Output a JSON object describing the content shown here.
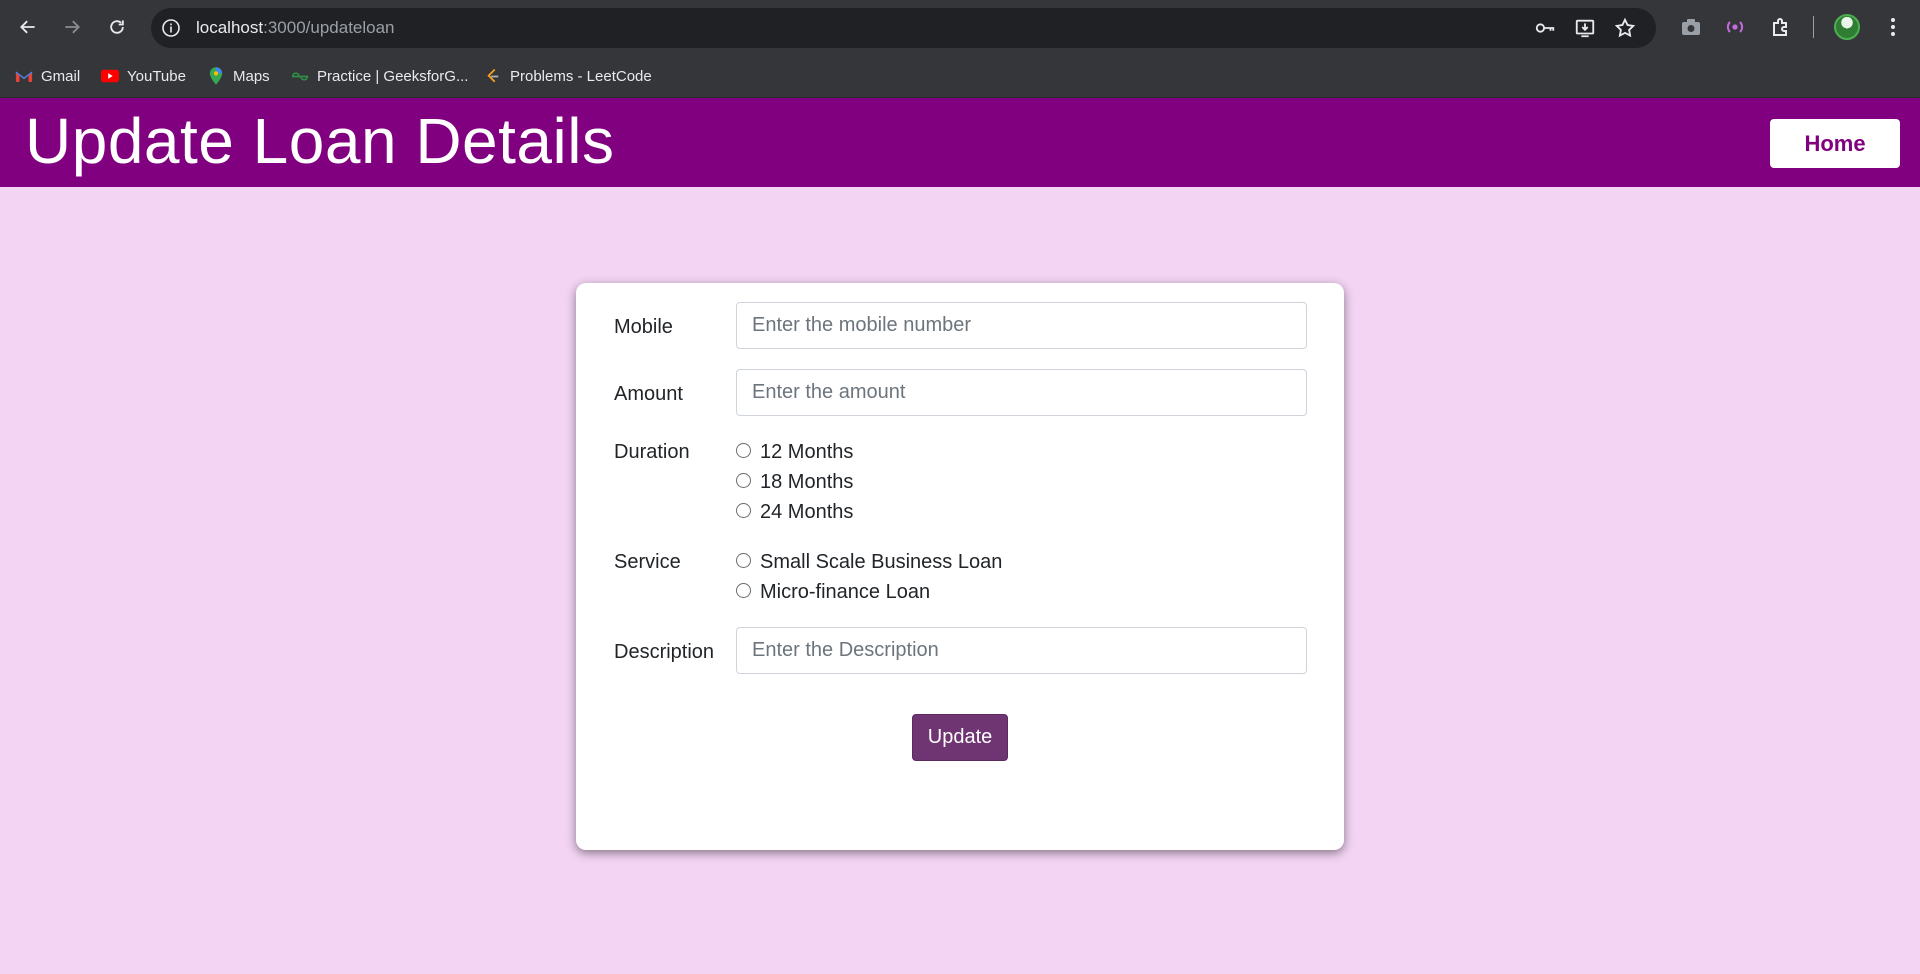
{
  "browser": {
    "url_host": "localhost",
    "url_path": ":3000/updateloan",
    "bookmarks": [
      {
        "label": "Gmail",
        "icon": "gmail-icon"
      },
      {
        "label": "YouTube",
        "icon": "youtube-icon"
      },
      {
        "label": "Maps",
        "icon": "maps-icon"
      },
      {
        "label": "Practice | GeeksforG...",
        "icon": "geeksforgeeks-icon"
      },
      {
        "label": "Problems - LeetCode",
        "icon": "leetcode-icon"
      }
    ]
  },
  "header": {
    "title": "Update Loan Details",
    "home_label": "Home",
    "background_color": "#800080"
  },
  "form": {
    "mobile": {
      "label": "Mobile",
      "placeholder": "Enter the mobile number",
      "value": ""
    },
    "amount": {
      "label": "Amount",
      "placeholder": "Enter the amount",
      "value": ""
    },
    "duration": {
      "label": "Duration",
      "options": [
        "12 Months",
        "18 Months",
        "24 Months"
      ],
      "selected": null
    },
    "service": {
      "label": "Service",
      "options": [
        "Small Scale Business Loan",
        "Micro-finance Loan"
      ],
      "selected": null
    },
    "description": {
      "label": "Description",
      "placeholder": "Enter the Description",
      "value": ""
    },
    "submit_label": "Update"
  },
  "colors": {
    "page_background": "#f3d4f3",
    "accent": "#800080",
    "button": "#6f3472"
  }
}
